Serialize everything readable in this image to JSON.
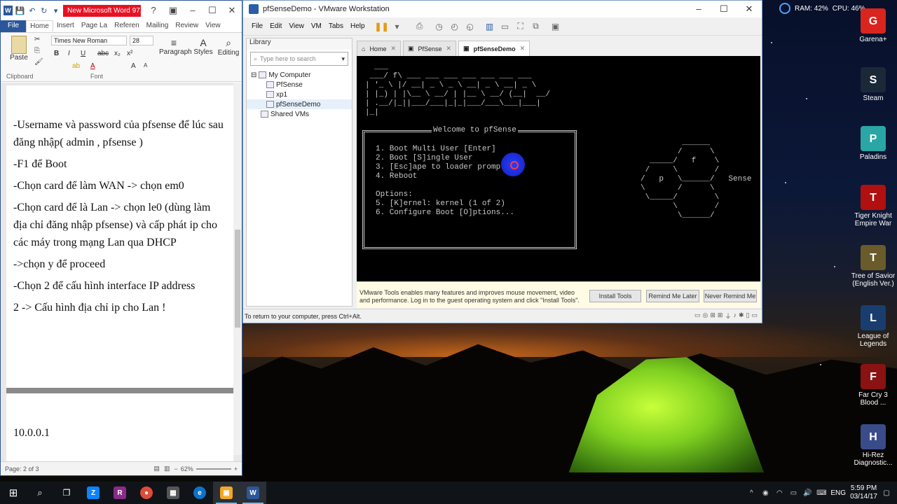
{
  "desktop": {
    "icons": [
      {
        "label": "Garena+",
        "color": "#d9251d",
        "glyph": "G"
      },
      {
        "label": "Steam",
        "color": "#1b2838",
        "glyph": "S"
      },
      {
        "label": "Paladins",
        "color": "#2aa7a5",
        "glyph": "P"
      },
      {
        "label": "Tiger Knight Empire War",
        "color": "#b01010",
        "glyph": "T"
      },
      {
        "label": "Tree of Savior (English Ver.)",
        "color": "#6a5b2a",
        "glyph": "T"
      },
      {
        "label": "League of Legends",
        "color": "#1a3d70",
        "glyph": "L"
      },
      {
        "label": "Far Cry 3 Blood ...",
        "color": "#8a1212",
        "glyph": "F"
      },
      {
        "label": "Hi-Rez Diagnostic...",
        "color": "#3a4b8a",
        "glyph": "H"
      }
    ],
    "gauge": {
      "ram": "RAM: 42%",
      "cpu": "CPU: 46%"
    }
  },
  "word": {
    "title": "New Microsoft Word 97...",
    "tabs": [
      "File",
      "Home",
      "Insert",
      "Page La",
      "Referen",
      "Mailing",
      "Review",
      "View"
    ],
    "ribbon": {
      "paste": "Paste",
      "clipboard": "Clipboard",
      "font_name": "Times New Roman",
      "font_size": "28",
      "font_group": "Font",
      "paragraph": "Paragraph",
      "styles": "Styles",
      "editing": "Editing"
    },
    "body": [
      "-Username và password của pfsense để lúc sau đăng nhập( admin , pfsense )",
      "-F1 để Boot",
      "-Chọn card để làm WAN -> chọn em0",
      "-Chọn card để là Lan -> chọn le0 (dùng làm địa chỉ đăng nhập pfsense) và cấp phát ip cho các máy trong mạng Lan qua DHCP",
      "->chọn y để proceed",
      "-Chọn 2 để cấu hình interface IP address",
      "2 -> Cấu hình địa chỉ ip cho Lan !"
    ],
    "page2_text": "10.0.0.1",
    "status": {
      "page": "Page: 2 of 3",
      "zoom": "62%"
    }
  },
  "vmware": {
    "title": "pfSenseDemo - VMware Workstation",
    "menu": [
      "File",
      "Edit",
      "View",
      "VM",
      "Tabs",
      "Help"
    ],
    "library": {
      "header": "Library",
      "search_placeholder": "Type here to search",
      "root": "My Computer",
      "vms": [
        "PfSense",
        "xp1",
        "pfSenseDemo"
      ],
      "shared": "Shared VMs"
    },
    "tabs": [
      "Home",
      "PfSense",
      "pfSenseDemo"
    ],
    "console": {
      "logo": "  ___\n ___/ f\\ ___ ___ ___ ___ ___ ___ ___\n| '_ \\ |/ __| _ \\ _ \\ __| _ \\ __| _ \\\n| |_) | |\\__ \\ __/ | |__ \\ __/ (__|  __/\n| .__/|_||___/___|_|_|___/___\\___|___|\n|_|",
      "menu_title": "Welcome to pfSense",
      "menu_items": [
        "1. Boot Multi User [Enter]",
        "2. Boot [S]ingle User",
        "3. [Esc]ape to loader prompt",
        "4. Reboot",
        "",
        "Options:",
        "5. [K]ernel: kernel (1 of 2)",
        "6. Configure Boot [O]ptions..."
      ],
      "hex_art": "              ______\n             /      \\\n       _____/   f    \\\n      /     \\        /\n     /   p   \\______/   Sense\n     \\       /      \\\n      \\_____/        \\\n            \\        /\n             \\______/"
    },
    "infobar": {
      "message": "VMware Tools enables many features and improves mouse movement, video and performance. Log in to the guest operating system and click \"Install Tools\".",
      "install": "Install Tools",
      "remind": "Remind Me Later",
      "never": "Never Remind Me"
    },
    "status": "To return to your computer, press Ctrl+Alt."
  },
  "taskbar": {
    "lang": "ENG",
    "time": "5:59 PM",
    "date": "03/14/17"
  }
}
